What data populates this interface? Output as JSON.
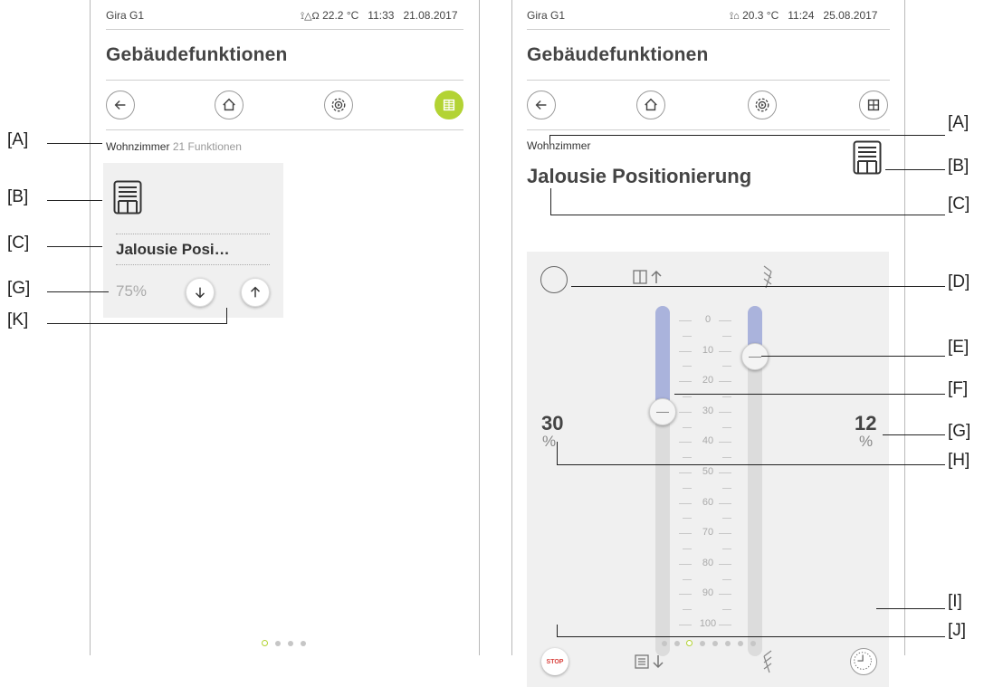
{
  "left": {
    "status": {
      "device": "Gira G1",
      "temp_icon": "⊪⍙⍜",
      "temp": "22.2 °C",
      "time": "11:33",
      "date": "21.08.2017"
    },
    "title": "Gebäudefunktionen",
    "breadcrumb": {
      "room": "Wohnzimmer",
      "count": "21",
      "count_label": "Funktionen"
    },
    "tile": {
      "name": "Jalousie Posi…",
      "value": "75%"
    }
  },
  "right": {
    "status": {
      "device": "Gira G1",
      "temp": "20.3 °C",
      "time": "11:24",
      "date": "25.08.2017"
    },
    "title": "Gebäudefunktionen",
    "room": "Wohnzimmer",
    "function_name": "Jalousie Positionierung",
    "position": {
      "value": "30",
      "unit": "%",
      "fraction": 0.3
    },
    "slat": {
      "value": "12",
      "unit": "%",
      "fraction": 0.12
    },
    "scale": [
      "0",
      "10",
      "20",
      "30",
      "40",
      "50",
      "60",
      "70",
      "80",
      "90",
      "100"
    ],
    "stop_label": "STOP"
  },
  "callouts": {
    "left": [
      "[A]",
      "[B]",
      "[C]",
      "[G]",
      "[K]"
    ],
    "right": [
      "[A]",
      "[B]",
      "[C]",
      "[D]",
      "[E]",
      "[F]",
      "[G]",
      "[H]",
      "[I]",
      "[J]"
    ]
  },
  "colors": {
    "accent": "#b3d334",
    "slider_fill": "#aab3dc",
    "stop": "#d9413c"
  }
}
